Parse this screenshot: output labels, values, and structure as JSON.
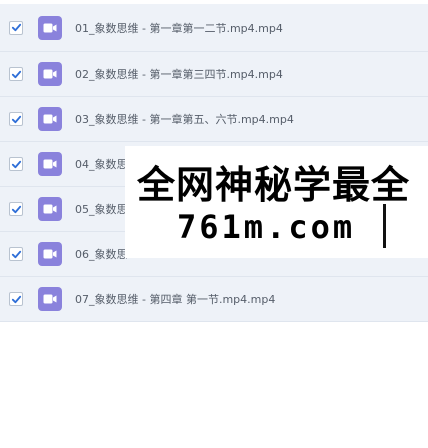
{
  "files": [
    {
      "name": "01_象数思维 - 第一章第一二节.mp4.mp4",
      "checked": true,
      "icon": "video-file-icon"
    },
    {
      "name": "02_象数思维 - 第一章第三四节.mp4.mp4",
      "checked": true,
      "icon": "video-file-icon"
    },
    {
      "name": "03_象数思维 - 第一章第五、六节.mp4.mp4",
      "checked": true,
      "icon": "video-file-icon"
    },
    {
      "name": "04_象数思",
      "checked": true,
      "icon": "video-file-icon"
    },
    {
      "name": "05_象数思",
      "checked": true,
      "icon": "video-file-icon"
    },
    {
      "name": "06_象数思",
      "checked": true,
      "icon": "video-file-icon"
    },
    {
      "name": "07_象数思维 - 第四章 第一节.mp4.mp4",
      "checked": true,
      "icon": "video-file-icon"
    }
  ],
  "watermark": {
    "line1": "全网神秘学最全",
    "line2": "761m.com"
  },
  "colors": {
    "row_bg": "#eef2f8",
    "checkbox_check": "#2f6fd8",
    "file_icon": "#8a82dc",
    "text": "#555d69"
  }
}
